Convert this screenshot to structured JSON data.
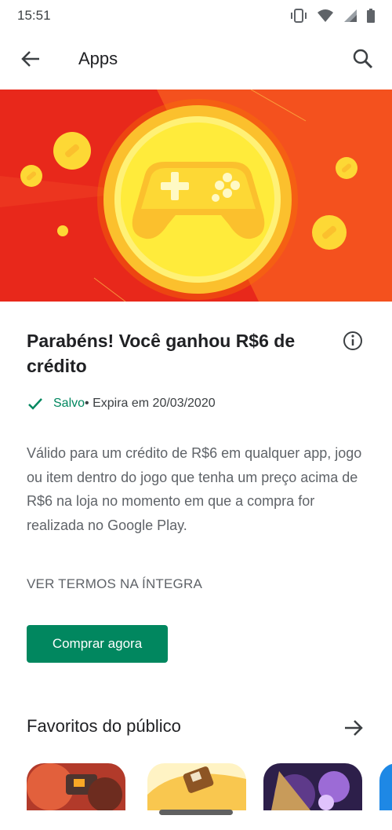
{
  "status_bar": {
    "time": "15:51",
    "icons": [
      "vibrate-icon",
      "wifi-icon",
      "signal-icon",
      "battery-icon"
    ]
  },
  "app_bar": {
    "title": "Apps",
    "back_icon": "arrow-back-icon",
    "search_icon": "search-icon"
  },
  "banner": {
    "icon": "gamepad-coin-icon",
    "colors": {
      "left": "#e8281b",
      "right": "#f4511e",
      "coin": "#fbc02d"
    }
  },
  "offer": {
    "headline": "Parabéns! Você ganhou R$6 de crédito",
    "saved_label": "Salvo",
    "expires_text": " • Expira em 20/03/2020",
    "description": "Válido para um crédito de R$6 em qualquer app, jogo ou item dentro do jogo que tenha um preço acima de R$6 na loja no momento em que a compra for realizada no Google Play.",
    "terms_link": "VER TERMOS NA ÍNTEGRA",
    "buy_button": "Comprar agora"
  },
  "favorites": {
    "title": "Favoritos do público",
    "arrow_icon": "arrow-forward-icon"
  },
  "accent_color": "#01875f"
}
